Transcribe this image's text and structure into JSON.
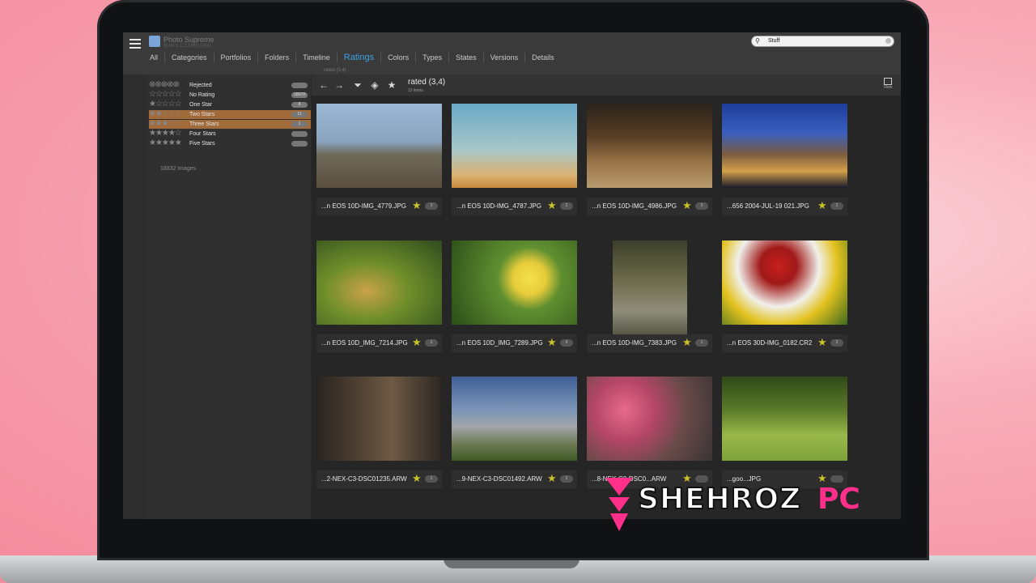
{
  "app": {
    "title": "Photo Supreme",
    "subtitle": "Build 5.1.2.1960 (x64)"
  },
  "search": {
    "value": "Stuff"
  },
  "tabs": [
    "All",
    "Categories",
    "Portfolios",
    "Folders",
    "Timeline",
    "Ratings",
    "Colors",
    "Types",
    "States",
    "Versions",
    "Details"
  ],
  "active_tab": "Ratings",
  "sub_tab": "rated (3,4)",
  "ratings": [
    {
      "stars": "⊗⊗⊗⊗⊗",
      "label": "Rejected",
      "count": "",
      "selected": false
    },
    {
      "stars": "☆☆☆☆☆",
      "label": "No Rating",
      "count": "18079",
      "selected": false
    },
    {
      "stars": "★☆☆☆☆",
      "label": "One Star",
      "count": "8",
      "selected": false
    },
    {
      "stars": "★★☆☆☆",
      "label": "Two Stars",
      "count": "11",
      "selected": true
    },
    {
      "stars": "★★★☆☆",
      "label": "Three Stars",
      "count": "1",
      "selected": true
    },
    {
      "stars": "★★★★☆",
      "label": "Four Stars",
      "count": "",
      "selected": false
    },
    {
      "stars": "★★★★★",
      "label": "Five Stars",
      "count": "",
      "selected": false
    }
  ],
  "images_total": "18832 images",
  "content": {
    "title": "rated   (3,4)",
    "subtitle": "12 items",
    "view_label": "View"
  },
  "thumbnails": [
    {
      "name": "...n EOS 10D-IMG_4779.JPG",
      "rating": "3",
      "art": "p1"
    },
    {
      "name": "...n EOS 10D-IMG_4787.JPG",
      "rating": "2",
      "art": "p2"
    },
    {
      "name": "...n EOS 10D-IMG_4986.JPG",
      "rating": "3",
      "art": "p3"
    },
    {
      "name": "...656 2004-JUL-19 021.JPG",
      "rating": "2",
      "art": "p4"
    },
    {
      "name": "...n EOS 10D_IMG_7214.JPG",
      "rating": "3",
      "art": "p5"
    },
    {
      "name": "...n EOS 10D_IMG_7289.JPG",
      "rating": "4",
      "art": "p6"
    },
    {
      "name": "...n EOS 10D-IMG_7383.JPG",
      "rating": "1",
      "art": "p7"
    },
    {
      "name": "...n EOS 30D-IMG_0182.CR2",
      "rating": "3",
      "art": "p8"
    },
    {
      "name": "...2-NEX-C3-DSC01235.ARW",
      "rating": "1",
      "art": "p9"
    },
    {
      "name": "...9-NEX-C3-DSC01492.ARW",
      "rating": "2",
      "art": "p10"
    },
    {
      "name": "...8-NEX-C3-DSC0...ARW",
      "rating": "",
      "art": "p11"
    },
    {
      "name": "...goo...JPG",
      "rating": "",
      "art": "p12"
    }
  ],
  "watermark": {
    "part1": "SHEHROZ",
    "part2": "PC"
  },
  "colors": {
    "accent": "#3aa3e0",
    "selection": "#a06a3a",
    "star": "#c9c22a",
    "watermark": "#ff2f8a"
  }
}
